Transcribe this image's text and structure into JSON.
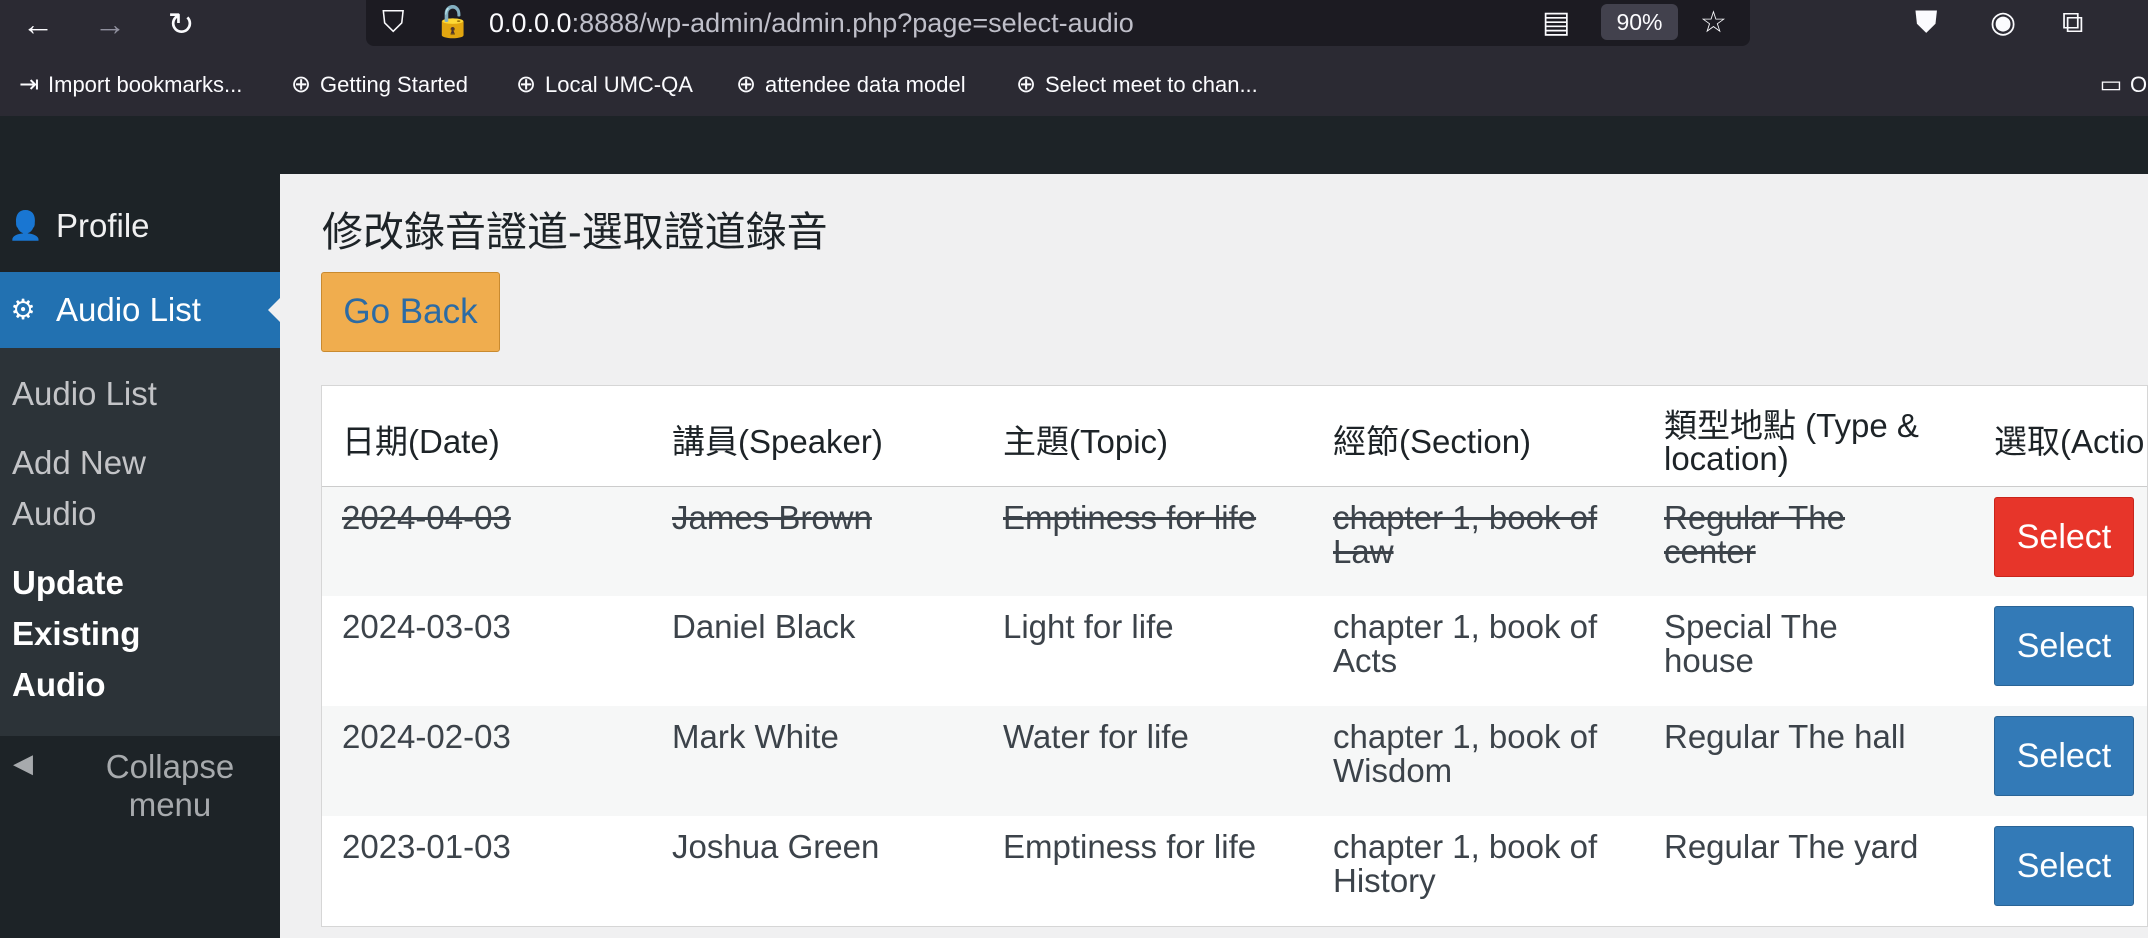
{
  "browser": {
    "url_host": "0.0.0.0",
    "url_rest": ":8888/wp-admin/admin.php?page=select-audio",
    "zoom": "90%",
    "icons": [
      "back-icon",
      "forward-icon",
      "reload-icon",
      "shield-icon",
      "insecure-lock-icon",
      "reader-view-icon",
      "star-icon",
      "pocket-icon",
      "account-icon",
      "extensions-icon"
    ]
  },
  "bookmarks": {
    "items": [
      {
        "label": "Import bookmarks...",
        "icon": "import-icon"
      },
      {
        "label": "Getting Started",
        "icon": "globe-icon"
      },
      {
        "label": "Local UMC-QA",
        "icon": "globe-icon"
      },
      {
        "label": "attendee data model",
        "icon": "globe-icon"
      },
      {
        "label": "Select meet to chan...",
        "icon": "globe-icon"
      }
    ],
    "overflow_label": "O"
  },
  "sidebar": {
    "profile_label": "Profile",
    "audio_list_label": "Audio List",
    "submenu": [
      {
        "label": "Audio List"
      },
      {
        "label": "Add New Audio"
      },
      {
        "label": "Update Existing Audio"
      }
    ],
    "collapse_label": "Collapse menu"
  },
  "main": {
    "title": "修改錄音證道-選取證道錄音",
    "go_back_label": "Go Back",
    "table": {
      "headers": [
        "日期(Date)",
        "講員(Speaker)",
        "主題(Topic)",
        "經節(Section)",
        "類型地點 (Type & location)",
        "選取(Actio"
      ],
      "rows": [
        {
          "date": "2024-04-03",
          "speaker": "James Brown",
          "topic": "Emptiness for life",
          "section": "chapter 1, book of Law",
          "type_location": "Regular The center",
          "action": "Select"
        },
        {
          "date": "2024-03-03",
          "speaker": "Daniel Black",
          "topic": "Light for life",
          "section": "chapter 1, book of Acts",
          "type_location": "Special The house",
          "action": "Select"
        },
        {
          "date": "2024-02-03",
          "speaker": "Mark White",
          "topic": "Water for life",
          "section": "chapter 1, book of Wisdom",
          "type_location": "Regular The hall",
          "action": "Select"
        },
        {
          "date": "2023-01-03",
          "speaker": "Joshua Green",
          "topic": "Emptiness for life",
          "section": "chapter 1, book of History",
          "type_location": "Regular The yard",
          "action": "Select"
        }
      ]
    }
  },
  "colors": {
    "admin_dark": "#1d2327",
    "admin_blue": "#2271b1",
    "go_back_bg": "#f0ad4e",
    "select_active_red": "#e7352a",
    "select_blue": "#337ab7"
  }
}
